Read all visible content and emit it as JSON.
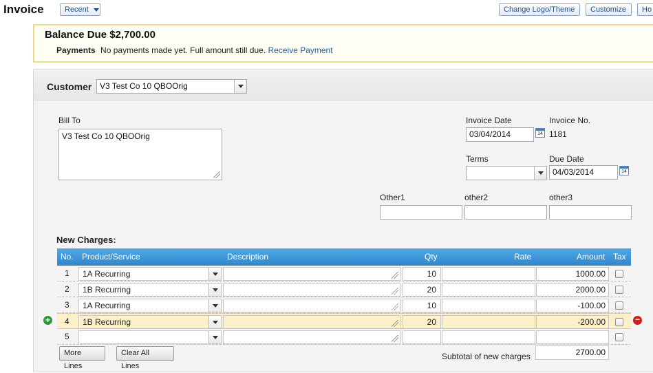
{
  "header": {
    "title": "Invoice",
    "recent_label": "Recent",
    "change_logo_label": "Change Logo/Theme",
    "customize_label": "Customize",
    "how_label": "Ho"
  },
  "balance": {
    "title": "Balance Due $2,700.00",
    "payments_label": "Payments",
    "payments_text": "No payments made yet. Full amount still due.",
    "receive_payment_link": "Receive Payment"
  },
  "customer": {
    "label": "Customer",
    "value": "V3 Test Co 10 QBOOrig"
  },
  "bill_to": {
    "label": "Bill To",
    "value": "V3 Test Co 10 QBOOrig"
  },
  "invoice_date": {
    "label": "Invoice Date",
    "value": "03/04/2014"
  },
  "invoice_no": {
    "label": "Invoice No.",
    "value": "1181"
  },
  "terms": {
    "label": "Terms",
    "value": ""
  },
  "due_date": {
    "label": "Due Date",
    "value": "04/03/2014"
  },
  "calendar_icon_text": "14",
  "other_fields": [
    {
      "label": "Other1",
      "value": ""
    },
    {
      "label": "other2",
      "value": ""
    },
    {
      "label": "other3",
      "value": ""
    }
  ],
  "charges": {
    "title": "New Charges:",
    "columns": {
      "no": "No.",
      "product": "Product/Service",
      "description": "Description",
      "qty": "Qty",
      "rate": "Rate",
      "amount": "Amount",
      "tax": "Tax"
    },
    "rows": [
      {
        "no": "1",
        "product": "1A Recurring",
        "description": "",
        "qty": "10",
        "rate": "",
        "amount": "1000.00",
        "tax": false
      },
      {
        "no": "2",
        "product": "1B Recurring",
        "description": "",
        "qty": "20",
        "rate": "",
        "amount": "2000.00",
        "tax": false
      },
      {
        "no": "3",
        "product": "1A Recurring",
        "description": "",
        "qty": "10",
        "rate": "",
        "amount": "-100.00",
        "tax": false
      },
      {
        "no": "4",
        "product": "1B Recurring",
        "description": "",
        "qty": "20",
        "rate": "",
        "amount": "-200.00",
        "tax": false
      },
      {
        "no": "5",
        "product": "",
        "description": "",
        "qty": "",
        "rate": "",
        "amount": "",
        "tax": false
      }
    ],
    "highlighted_row": 4,
    "more_lines_label": "More Lines",
    "clear_all_lines_label": "Clear All Lines",
    "subtotal_label": "Subtotal of new charges",
    "subtotal_value": "2700.00"
  },
  "colors": {
    "table_header": "#2c87cf",
    "highlight_row": "#fbf0c8",
    "balance_border": "#f0d98a",
    "link": "#1f5fa8"
  }
}
